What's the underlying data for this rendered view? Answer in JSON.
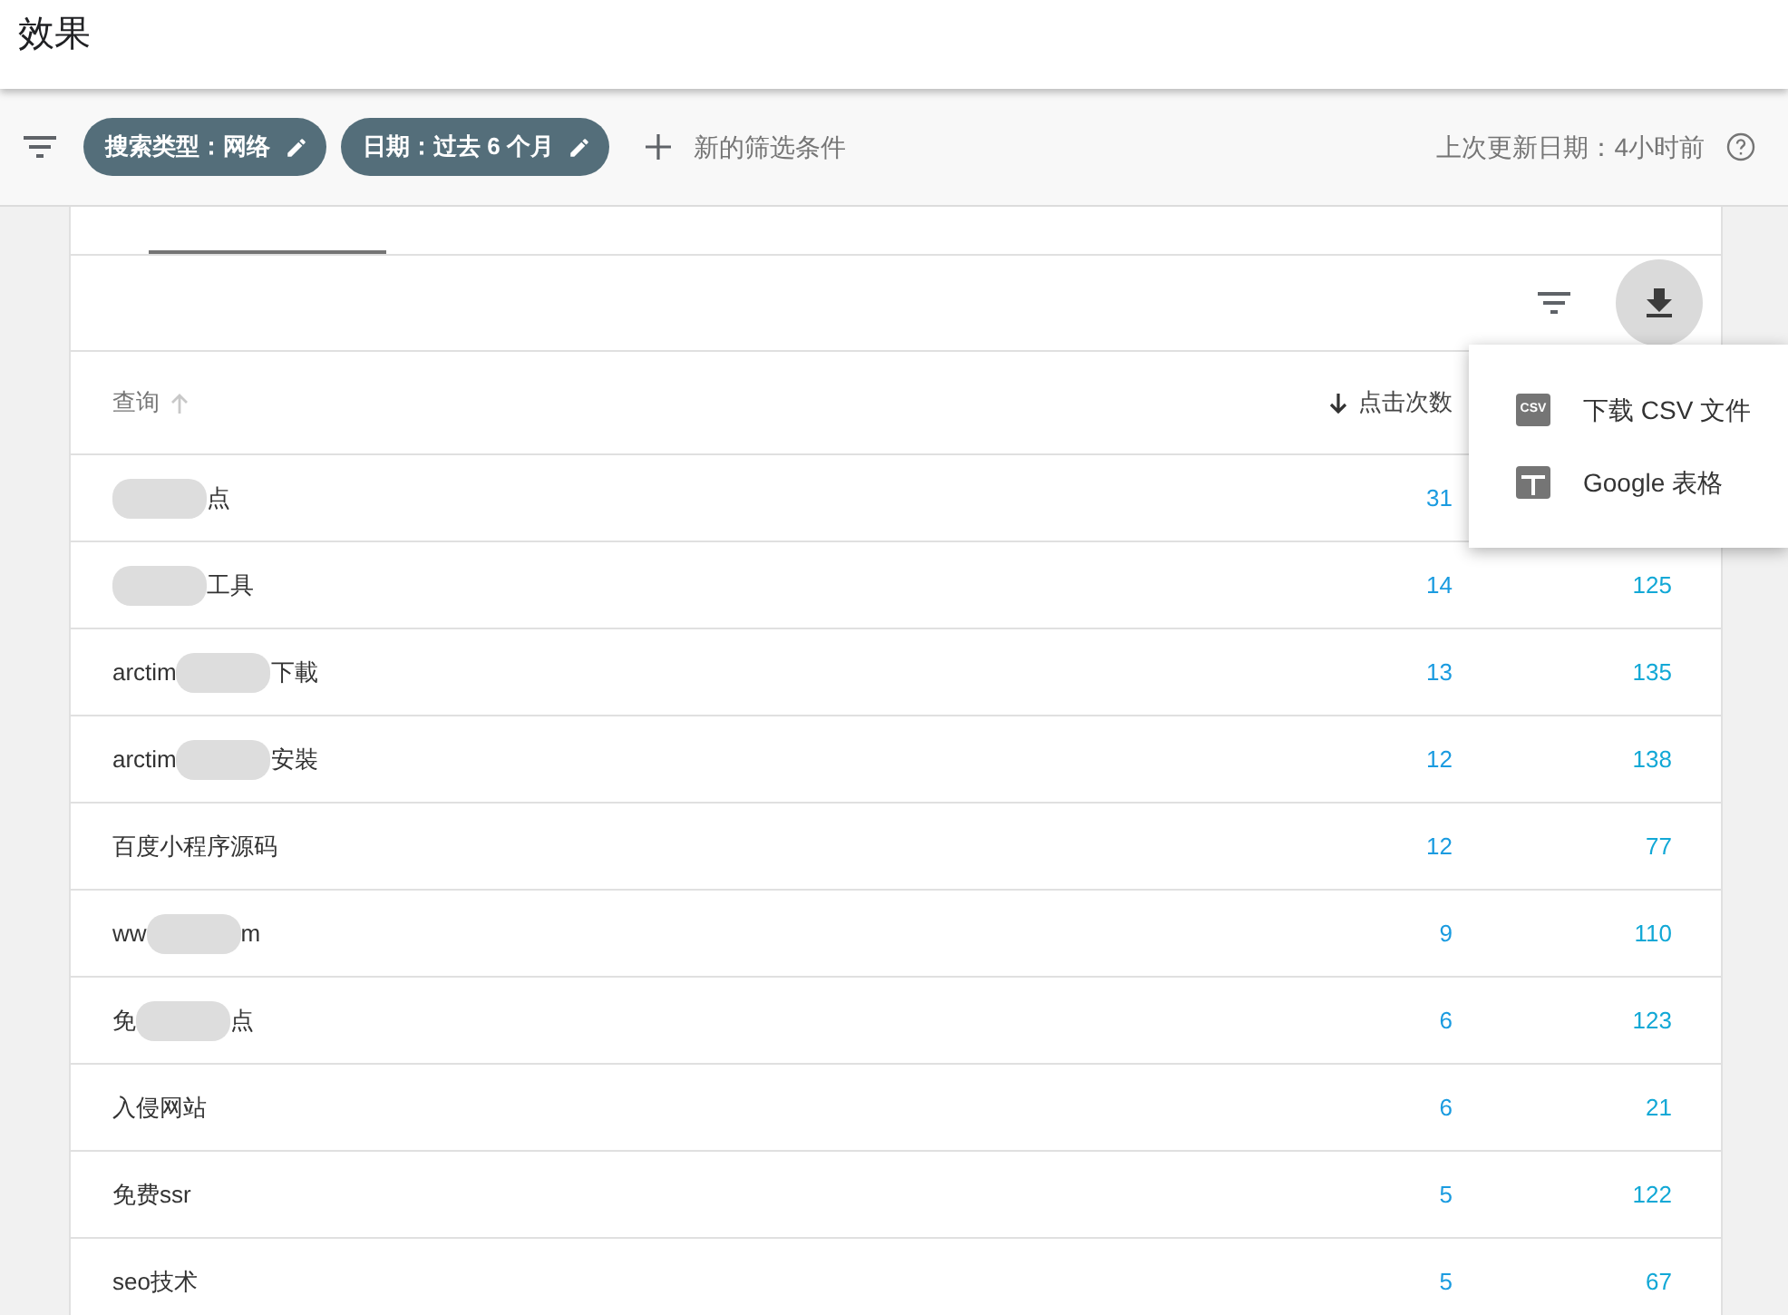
{
  "header": {
    "title": "效果"
  },
  "filter_bar": {
    "chips": [
      {
        "label": "搜索类型：网络"
      },
      {
        "label": "日期：过去 6 个月"
      }
    ],
    "add_filter": "新的筛选条件",
    "last_updated": "上次更新日期：4小时前"
  },
  "table": {
    "columns": [
      {
        "label": "查询",
        "ascending": true
      },
      {
        "label": "点击次数",
        "ascending": false
      }
    ],
    "rows": [
      {
        "query_before": "",
        "redacted": true,
        "query_after": "点",
        "column_2": "31"
      },
      {
        "query_before": "",
        "redacted": true,
        "query_after": "工具",
        "column_2": "14",
        "column_3": "125"
      },
      {
        "query_before": "arctim",
        "redacted": true,
        "query_after": "下載",
        "column_2": "13",
        "column_3": "135"
      },
      {
        "query_before": "arctim",
        "redacted": true,
        "query_after": "安裝",
        "column_2": "12",
        "column_3": "138"
      },
      {
        "query_before": "百度小程序源码",
        "redacted": false,
        "query_after": "",
        "column_2": "12",
        "column_3": "77"
      },
      {
        "query_before": "ww",
        "redacted": true,
        "query_after": "m",
        "column_2": "9",
        "column_3": "110"
      },
      {
        "query_before": "免",
        "redacted": true,
        "query_after": "点",
        "column_2": "6",
        "column_3": "123"
      },
      {
        "query_before": "入侵网站",
        "redacted": false,
        "query_after": "",
        "column_2": "6",
        "column_3": "21"
      },
      {
        "query_before": "免费ssr",
        "redacted": false,
        "query_after": "",
        "column_2": "5",
        "column_3": "122"
      },
      {
        "query_before": "seo技术",
        "redacted": false,
        "query_after": "",
        "column_2": "5",
        "column_3": "67"
      }
    ]
  },
  "download_menu": {
    "items": [
      {
        "kind": "csv",
        "label": "下载 CSV 文件",
        "icon_text": "CSV"
      },
      {
        "kind": "sheets",
        "label": "Google 表格"
      }
    ]
  }
}
